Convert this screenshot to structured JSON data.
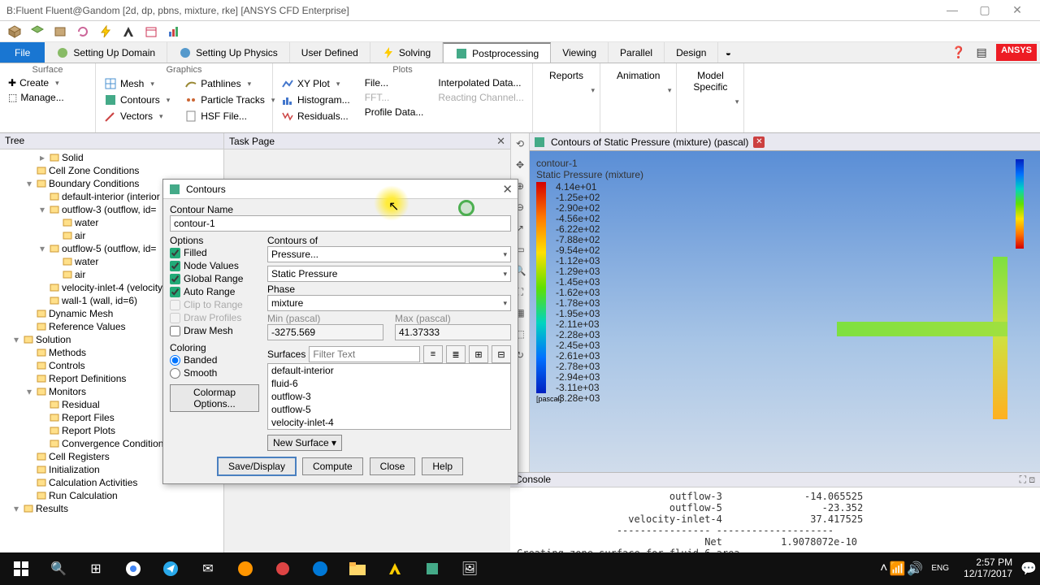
{
  "window": {
    "title": "B:Fluent Fluent@Gandom [2d, dp, pbns, mixture, rke] [ANSYS CFD Enterprise]"
  },
  "ribbon": {
    "file": "File",
    "tabs": [
      "Setting Up Domain",
      "Setting Up Physics",
      "User Defined",
      "Solving",
      "Postprocessing",
      "Viewing",
      "Parallel",
      "Design"
    ],
    "active": "Postprocessing",
    "ansys": "ANSYS"
  },
  "groups": {
    "surface": {
      "label": "Surface",
      "create": "Create",
      "manage": "Manage..."
    },
    "graphics": {
      "label": "Graphics",
      "mesh": "Mesh",
      "contours": "Contours",
      "vectors": "Vectors",
      "pathlines": "Pathlines",
      "particle": "Particle Tracks",
      "hsf": "HSF File..."
    },
    "plots": {
      "label": "Plots",
      "xy": "XY Plot",
      "hist": "Histogram...",
      "resid": "Residuals...",
      "file": "File...",
      "fft": "FFT...",
      "profile": "Profile Data...",
      "interp": "Interpolated Data...",
      "react": "Reacting Channel..."
    },
    "reports": "Reports",
    "animation": "Animation",
    "model": "Model\nSpecific"
  },
  "tree": {
    "header": "Tree",
    "nodes": [
      {
        "d": 2,
        "tw": "▸",
        "label": "Solid"
      },
      {
        "d": 1,
        "tw": "",
        "label": "Cell Zone Conditions"
      },
      {
        "d": 1,
        "tw": "▾",
        "label": "Boundary Conditions"
      },
      {
        "d": 2,
        "tw": "",
        "label": "default-interior (interior"
      },
      {
        "d": 2,
        "tw": "▾",
        "label": "outflow-3 (outflow, id="
      },
      {
        "d": 3,
        "tw": "",
        "label": "water"
      },
      {
        "d": 3,
        "tw": "",
        "label": "air"
      },
      {
        "d": 2,
        "tw": "▾",
        "label": "outflow-5 (outflow, id="
      },
      {
        "d": 3,
        "tw": "",
        "label": "water"
      },
      {
        "d": 3,
        "tw": "",
        "label": "air"
      },
      {
        "d": 2,
        "tw": "",
        "label": "velocity-inlet-4 (velocity"
      },
      {
        "d": 2,
        "tw": "",
        "label": "wall-1 (wall, id=6)"
      },
      {
        "d": 1,
        "tw": "",
        "label": "Dynamic Mesh"
      },
      {
        "d": 1,
        "tw": "",
        "label": "Reference Values"
      },
      {
        "d": 0,
        "tw": "▾",
        "label": "Solution"
      },
      {
        "d": 1,
        "tw": "",
        "label": "Methods"
      },
      {
        "d": 1,
        "tw": "",
        "label": "Controls"
      },
      {
        "d": 1,
        "tw": "",
        "label": "Report Definitions"
      },
      {
        "d": 1,
        "tw": "▾",
        "label": "Monitors"
      },
      {
        "d": 2,
        "tw": "",
        "label": "Residual"
      },
      {
        "d": 2,
        "tw": "",
        "label": "Report Files"
      },
      {
        "d": 2,
        "tw": "",
        "label": "Report Plots"
      },
      {
        "d": 2,
        "tw": "",
        "label": "Convergence Conditions"
      },
      {
        "d": 1,
        "tw": "",
        "label": "Cell Registers"
      },
      {
        "d": 1,
        "tw": "",
        "label": "Initialization"
      },
      {
        "d": 1,
        "tw": "",
        "label": "Calculation Activities"
      },
      {
        "d": 1,
        "tw": "",
        "label": "Run Calculation"
      },
      {
        "d": 0,
        "tw": "▾",
        "label": "Results"
      }
    ]
  },
  "taskpage": "Task Page",
  "dialog": {
    "title": "Contours",
    "name_label": "Contour Name",
    "name": "contour-1",
    "options_label": "Options",
    "opts": {
      "filled": "Filled",
      "node": "Node Values",
      "global": "Global Range",
      "auto": "Auto Range",
      "clip": "Clip to Range",
      "profiles": "Draw Profiles",
      "mesh": "Draw Mesh"
    },
    "coloring_label": "Coloring",
    "banded": "Banded",
    "smooth": "Smooth",
    "colormap": "Colormap Options...",
    "contours_of": "Contours of",
    "pressure": "Pressure...",
    "static": "Static Pressure",
    "phase_label": "Phase",
    "phase": "mixture",
    "min_label": "Min (pascal)",
    "min": "-3275.569",
    "max_label": "Max (pascal)",
    "max": "41.37333",
    "surfaces_label": "Surfaces",
    "filter": "Filter Text",
    "surfaces": [
      "default-interior",
      "fluid-6",
      "outflow-3",
      "outflow-5",
      "velocity-inlet-4"
    ],
    "new_surface": "New Surface",
    "save": "Save/Display",
    "compute": "Compute",
    "close": "Close",
    "help": "Help"
  },
  "vis": {
    "title": "Contours of Static Pressure (mixture)  (pascal)",
    "sub1": "contour-1",
    "sub2": "Static Pressure (mixture)",
    "legend": [
      "4.14e+01",
      "-1.25e+02",
      "-2.90e+02",
      "-4.56e+02",
      "-6.22e+02",
      "-7.88e+02",
      "-9.54e+02",
      "-1.12e+03",
      "-1.29e+03",
      "-1.45e+03",
      "-1.62e+03",
      "-1.78e+03",
      "-1.95e+03",
      "-2.11e+03",
      "-2.28e+03",
      "-2.45e+03",
      "-2.61e+03",
      "-2.78e+03",
      "-2.94e+03",
      "-3.11e+03",
      "-3.28e+03"
    ],
    "unit": "[pascal]"
  },
  "console": {
    "header": "Console",
    "text": "                          outflow-3              -14.065525\n                          outflow-5                 -23.352\n                   velocity-inlet-4               37.417525\n                 ---------------- --------------------\n                                Net          1.9078072e-10\nCreating zone surface for fluid-6 area"
  },
  "tray": {
    "lang": "ENG",
    "time": "2:57 PM",
    "date": "12/17/2017"
  }
}
